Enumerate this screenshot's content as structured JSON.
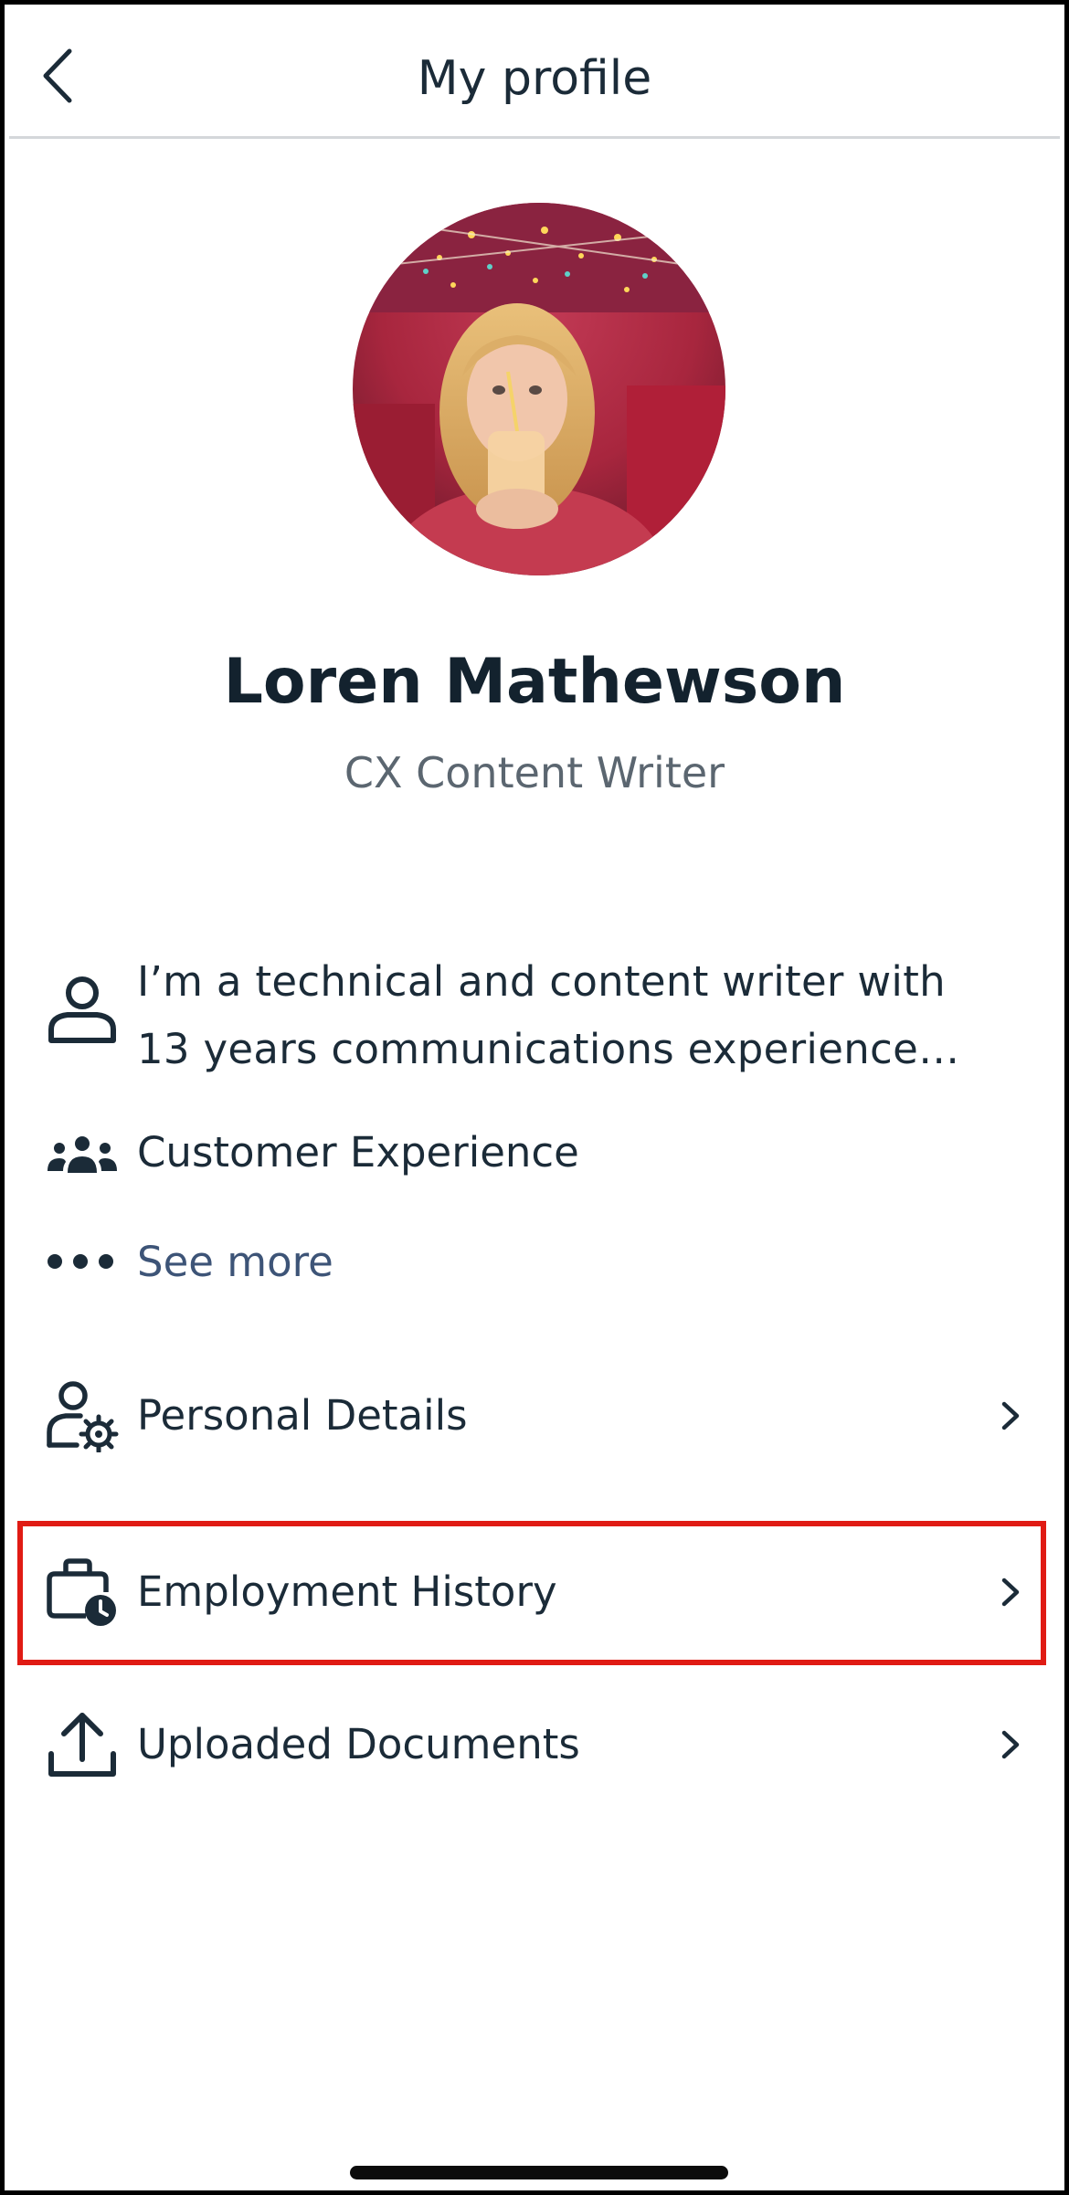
{
  "header": {
    "title": "My profile",
    "back_icon": "chevron-left-icon"
  },
  "profile": {
    "avatar_icon": "profile-photo",
    "name": "Loren Mathewson",
    "job_title": "CX Content Writer"
  },
  "about": {
    "bio_line_1": "I’m a technical and content writer with",
    "bio_line_2": "13 years communications experience…",
    "bio_icon": "person-icon",
    "department": "Customer Experience",
    "department_icon": "team-icon",
    "see_more": "See more",
    "see_more_icon": "more-dots-icon"
  },
  "menu": {
    "items": [
      {
        "label": "Personal Details",
        "icon": "person-gear-icon"
      },
      {
        "label": "Employment History",
        "icon": "briefcase-clock-icon",
        "highlighted": true
      },
      {
        "label": "Uploaded Documents",
        "icon": "upload-icon"
      }
    ]
  },
  "colors": {
    "text": "#1b2b38",
    "muted": "#5b6670",
    "link": "#3d5477",
    "highlight": "#e01b14",
    "divider": "#d4d7da"
  }
}
